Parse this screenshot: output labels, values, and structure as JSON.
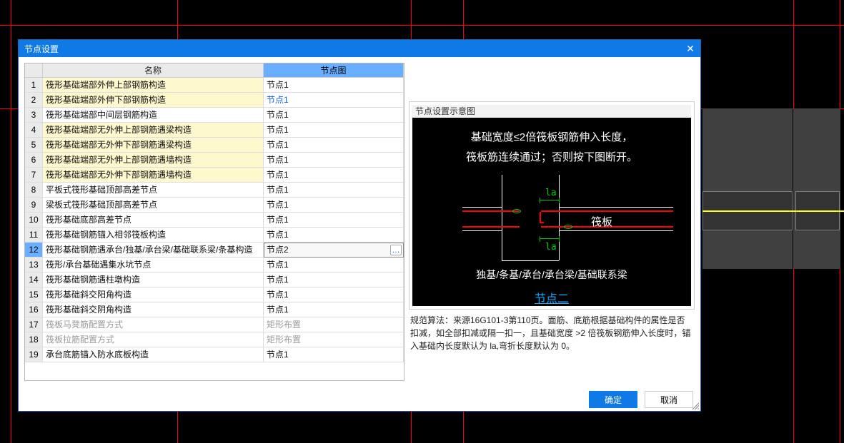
{
  "dialog": {
    "title": "节点设置",
    "close_glyph": "✕"
  },
  "table": {
    "headers": {
      "num": "",
      "name": "名称",
      "node": "节点图"
    },
    "rows": [
      {
        "n": "1",
        "name": "筏形基础端部外伸上部钢筋构造",
        "node": "节点1",
        "yellow": true,
        "blue": false,
        "sel": false
      },
      {
        "n": "2",
        "name": "筏形基础端部外伸下部钢筋构造",
        "node": "节点1",
        "yellow": true,
        "blue": true,
        "sel": false
      },
      {
        "n": "3",
        "name": "筏形基础端部中间层钢筋构造",
        "node": "节点1",
        "yellow": false,
        "blue": false,
        "sel": false
      },
      {
        "n": "4",
        "name": "筏形基础端部无外伸上部钢筋遇梁构造",
        "node": "节点1",
        "yellow": true,
        "blue": false,
        "sel": false
      },
      {
        "n": "5",
        "name": "筏形基础端部无外伸下部钢筋遇梁构造",
        "node": "节点1",
        "yellow": true,
        "blue": false,
        "sel": false
      },
      {
        "n": "6",
        "name": "筏形基础端部无外伸上部钢筋遇墙构造",
        "node": "节点1",
        "yellow": true,
        "blue": false,
        "sel": false
      },
      {
        "n": "7",
        "name": "筏形基础端部无外伸下部钢筋遇墙构造",
        "node": "节点1",
        "yellow": true,
        "blue": false,
        "sel": false
      },
      {
        "n": "8",
        "name": "平板式筏形基础顶部高差节点",
        "node": "节点1",
        "yellow": false,
        "blue": false,
        "sel": false
      },
      {
        "n": "9",
        "name": "梁板式筏形基础顶部高差节点",
        "node": "节点1",
        "yellow": false,
        "blue": false,
        "sel": false
      },
      {
        "n": "10",
        "name": "筏形基础底部高差节点",
        "node": "节点1",
        "yellow": false,
        "blue": false,
        "sel": false
      },
      {
        "n": "11",
        "name": "筏形基础钢筋锚入相邻筏板构造",
        "node": "节点1",
        "yellow": false,
        "blue": false,
        "sel": false
      },
      {
        "n": "12",
        "name": "筏形基础钢筋遇承台/独基/承台梁/基础联系梁/条基构造",
        "node": "节点2",
        "yellow": false,
        "blue": false,
        "sel": true
      },
      {
        "n": "13",
        "name": "筏形/承台基础遇集水坑节点",
        "node": "节点1",
        "yellow": false,
        "blue": false,
        "sel": false
      },
      {
        "n": "14",
        "name": "筏形基础钢筋遇柱墩构造",
        "node": "节点1",
        "yellow": false,
        "blue": false,
        "sel": false
      },
      {
        "n": "15",
        "name": "筏形基础斜交阳角构造",
        "node": "节点1",
        "yellow": false,
        "blue": false,
        "sel": false
      },
      {
        "n": "16",
        "name": "筏形基础斜交阴角构造",
        "node": "节点1",
        "yellow": false,
        "blue": false,
        "sel": false
      },
      {
        "n": "17",
        "name": "筏板马凳筋配置方式",
        "node": "矩形布置",
        "yellow": false,
        "blue": false,
        "sel": false,
        "disabled": true
      },
      {
        "n": "18",
        "name": "筏板拉筋配置方式",
        "node": "矩形布置",
        "yellow": false,
        "blue": false,
        "sel": false,
        "disabled": true
      },
      {
        "n": "19",
        "name": "承台底筋锚入防水底板构造",
        "node": "节点1",
        "yellow": false,
        "blue": false,
        "sel": false
      }
    ],
    "more_glyph": "…"
  },
  "preview": {
    "legend": "节点设置示意图",
    "text1": "基础宽度≤2倍筏板钢筋伸入长度，",
    "text2": "筏板筋连续通过；否则按下图断开。",
    "la": "la",
    "fb_label": "筏板",
    "bottom_label": "独基/条基/承台/承台梁/基础联系梁",
    "node_title": "节点二"
  },
  "algorithm": "规范算法：来源16G101-3第110页。面筋、底筋根据基础构件的属性是否扣减，如全部扣减或隔一扣一，且基础宽度 >2 倍筏板钢筋伸入长度时，锚入基础内长度默认为 la,弯折长度默认为 0。",
  "buttons": {
    "ok": "确定",
    "cancel": "取消"
  }
}
